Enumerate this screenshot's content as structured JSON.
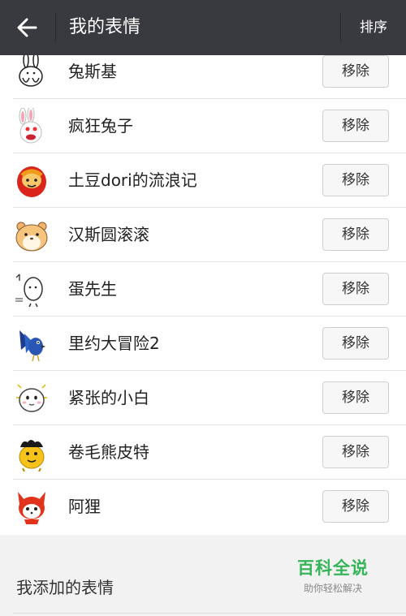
{
  "header": {
    "title": "我的表情",
    "sort_label": "排序"
  },
  "sticker_list": [
    {
      "name": "兔斯基",
      "remove_label": "移除",
      "icon": "rabbit-sketch-icon"
    },
    {
      "name": "疯狂兔子",
      "remove_label": "移除",
      "icon": "crazy-rabbit-icon"
    },
    {
      "name": "土豆dori的流浪记",
      "remove_label": "移除",
      "icon": "potato-dori-icon"
    },
    {
      "name": "汉斯圆滚滚",
      "remove_label": "移除",
      "icon": "hamster-icon"
    },
    {
      "name": "蛋先生",
      "remove_label": "移除",
      "icon": "egg-man-icon"
    },
    {
      "name": "里约大冒险2",
      "remove_label": "移除",
      "icon": "blue-parrot-icon"
    },
    {
      "name": "紧张的小白",
      "remove_label": "移除",
      "icon": "nervous-ghost-icon"
    },
    {
      "name": "卷毛熊皮特",
      "remove_label": "移除",
      "icon": "curly-bear-icon"
    },
    {
      "name": "阿狸",
      "remove_label": "移除",
      "icon": "ali-fox-icon"
    }
  ],
  "section": {
    "added_title": "我添加的表情"
  },
  "watermark": {
    "main": "百科全说",
    "sub": "助你轻松解决"
  }
}
